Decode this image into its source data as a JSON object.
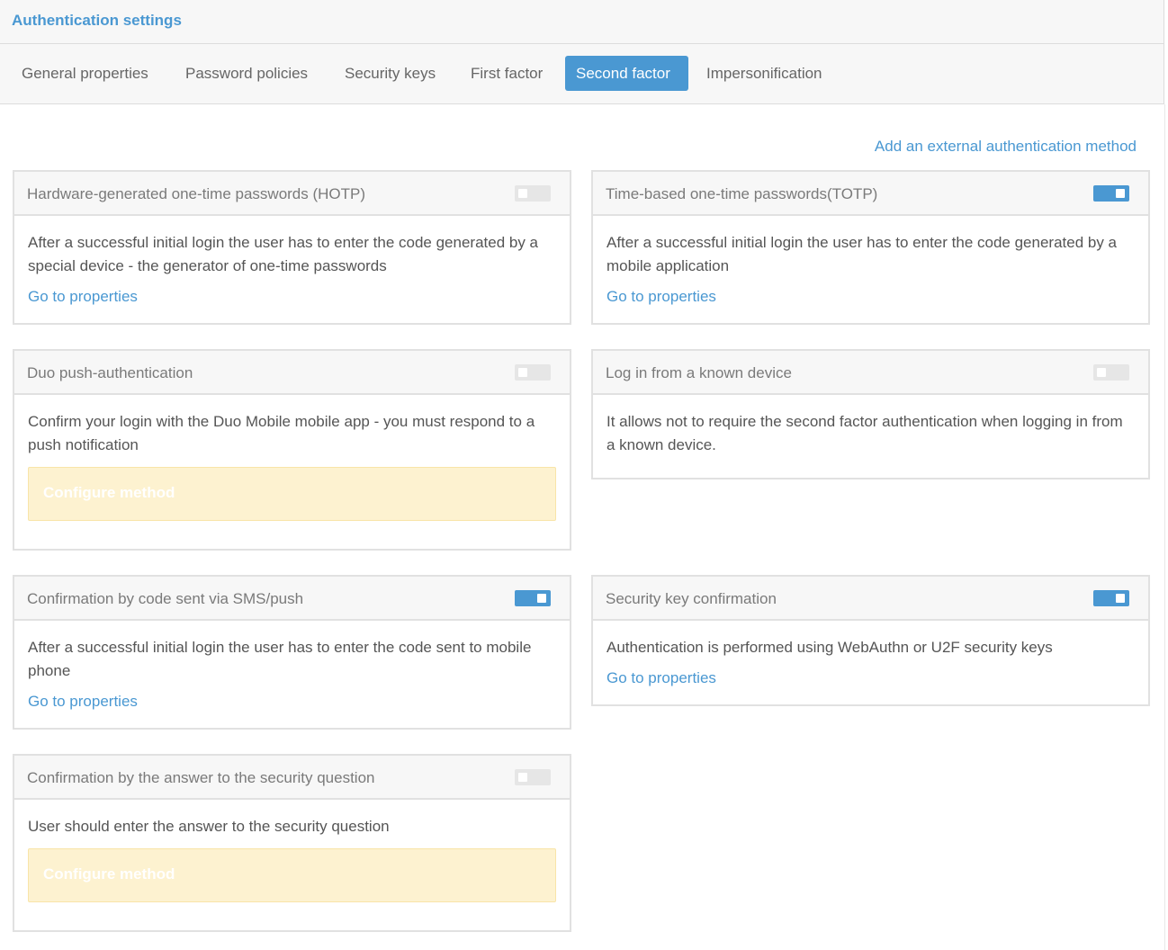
{
  "page": {
    "title": "Authentication settings"
  },
  "tabs": [
    {
      "label": "General properties",
      "active": false
    },
    {
      "label": "Password policies",
      "active": false
    },
    {
      "label": "Security keys",
      "active": false
    },
    {
      "label": "First factor",
      "active": false
    },
    {
      "label": "Second factor",
      "active": true
    },
    {
      "label": "Impersonification",
      "active": false
    }
  ],
  "actions": {
    "add_external": "Add an external authentication method"
  },
  "cards": {
    "hotp": {
      "title": "Hardware-generated one-time passwords (HOTP)",
      "enabled": false,
      "description": "After a successful initial login the user has to enter the code generated by a special device - the generator of one-time passwords",
      "link": "Go to properties"
    },
    "totp": {
      "title": "Time-based one-time passwords(TOTP)",
      "enabled": true,
      "description": "After a successful initial login the user has to enter the code generated by a mobile application",
      "link": "Go to properties"
    },
    "duo": {
      "title": "Duo push-authentication",
      "enabled": false,
      "description": "Confirm your login with the Duo Mobile mobile app - you must respond to a push notification",
      "configure": "Configure method"
    },
    "known_device": {
      "title": "Log in from a known device",
      "enabled": false,
      "description": "It allows not to require the second factor authentication when logging in from a known device."
    },
    "sms": {
      "title": "Confirmation by code sent via SMS/push",
      "enabled": true,
      "description": "After a successful initial login the user has to enter the code sent to mobile phone",
      "link": "Go to properties"
    },
    "security_key": {
      "title": "Security key confirmation",
      "enabled": true,
      "description": "Authentication is performed using WebAuthn or U2F security keys",
      "link": "Go to properties"
    },
    "security_question": {
      "title": "Confirmation by the answer to the security question",
      "enabled": false,
      "description": "User should enter the answer to the security question",
      "configure": "Configure method"
    }
  },
  "colors": {
    "accent": "#4a98d2",
    "configure_bg": "#fdf2d0",
    "toggle_off": "#e6e6e6"
  }
}
